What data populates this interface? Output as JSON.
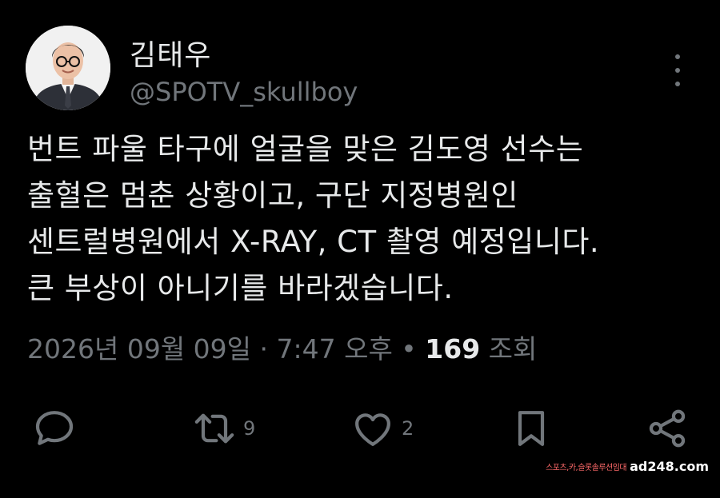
{
  "author": {
    "display_name": "김태우",
    "handle": "@SPOTV_skullboy"
  },
  "tweet": {
    "text": "번트 파울 타구에 얼굴을 맞은 김도영 선수는\n출혈은 멈춘 상황이고, 구단 지정병원인\n센트럴병원에서 X-RAY, CT 촬영 예정입니다.\n큰 부상이 아니기를 바라겠습니다.",
    "timestamp": "2026년 09월 09일 · 7:47 오후",
    "separator": " • ",
    "views_count": "169",
    "views_label": " 조회"
  },
  "actions": {
    "reply_count": "",
    "retweet_count": "9",
    "like_count": "2"
  },
  "icons": {
    "more": "more-vertical-icon",
    "reply": "speech-bubble-icon",
    "retweet": "retweet-icon",
    "like": "heart-icon",
    "bookmark": "bookmark-icon",
    "share": "share-icon"
  },
  "watermark": {
    "sub_text": "스포츠,카,슬롯솔루션임대",
    "main_text": "ad248.com"
  },
  "colors": {
    "background": "#000000",
    "text_primary": "#e7e9ea",
    "text_secondary": "#71767b",
    "watermark_accent": "#ff6a6a"
  }
}
